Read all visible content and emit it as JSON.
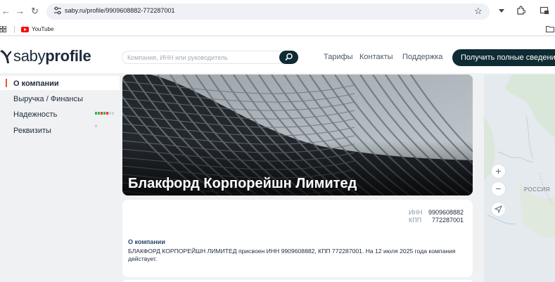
{
  "browser": {
    "url": "saby.ru/profile/9909608882-772287001",
    "bookmarks": [
      {
        "label": "YouTube",
        "icon": "youtube-icon"
      }
    ],
    "icons": [
      "back-icon",
      "forward-icon",
      "reload-icon",
      "site-info-icon",
      "bookmark-star-icon",
      "download-icon",
      "extensions-icon",
      "reading-list-icon",
      "apps-icon",
      "folder-icon"
    ]
  },
  "header": {
    "logo_light": "saby",
    "logo_bold": "profile",
    "search_placeholder": "Компания, ИНН или руководитель",
    "nav": [
      "Тарифы",
      "Контакты",
      "Поддержка"
    ],
    "cta": "Получить полные сведения"
  },
  "menu": {
    "items": [
      {
        "label": "О компании",
        "active": true
      },
      {
        "label": "Выручка / Финансы"
      },
      {
        "label": "Надежность"
      },
      {
        "label": "Реквизиты"
      }
    ],
    "reliability_colors": [
      "#3cb44a",
      "#3cb44a",
      "#e53935",
      "#3cb44a",
      "#e53935",
      "#d0d4d8",
      "#d0d4d8",
      "#d0d4d8"
    ]
  },
  "company": {
    "name": "Блакфорд Корпорейшн Лимитед",
    "inn_label": "ИНН",
    "inn": "9909608882",
    "kpp_label": "КПП",
    "kpp": "772287001",
    "section_title": "О компании",
    "description": "БЛАКФОРД КОРПОРЕЙШН ЛИМИТЕД присвоен ИНН 9909608882, КПП 772287001. На 12 июля 2025 года компания действует."
  },
  "map": {
    "country_label": "РОССИЯ",
    "controls": [
      "zoom-in-icon",
      "zoom-out-icon",
      "locate-icon"
    ]
  },
  "colors": {
    "accent": "#e8542a",
    "dark": "#0f2b33",
    "text": "#1e2b3c",
    "background": "#f0f1f3"
  }
}
